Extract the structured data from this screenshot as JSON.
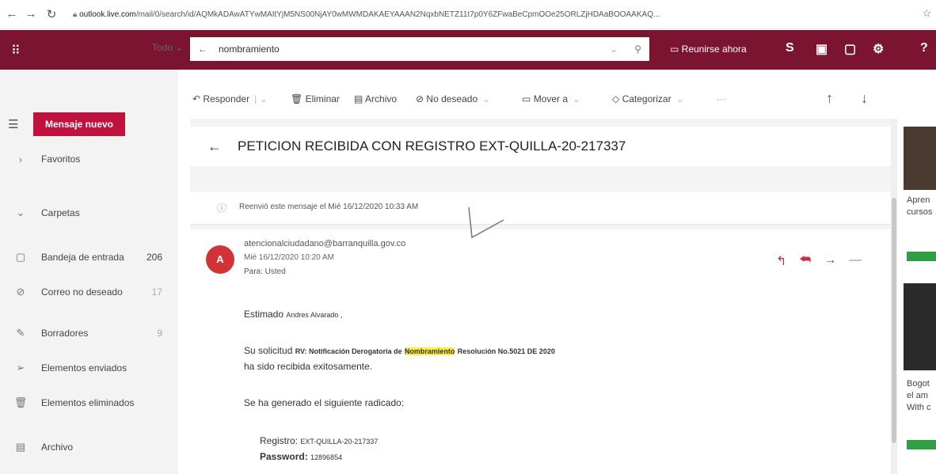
{
  "browser": {
    "url_host": "outlook.live.com",
    "url_path": "/mail/0/search/id/AQMkADAwATYwMAItYjM5NS00NjAY0wMWMDAKAEYAAAN2NqxbNETZ11t7p0Y6ZFwaBeCpmOOe25ORLZjHDAaBOOAAKAQ..."
  },
  "header": {
    "search_scope": "Todo",
    "search_value": "nombramiento",
    "meet_now": "Reunirse ahora"
  },
  "sidebar": {
    "new_message": "Mensaje nuevo",
    "items": [
      {
        "label": "Favoritos",
        "count": ""
      },
      {
        "label": "Carpetas",
        "count": ""
      },
      {
        "label": "Bandeja de entrada",
        "count": "206"
      },
      {
        "label": "Correo no deseado",
        "count": "17"
      },
      {
        "label": "Borradores",
        "count": "9"
      },
      {
        "label": "Elementos enviados",
        "count": ""
      },
      {
        "label": "Elementos eliminados",
        "count": ""
      },
      {
        "label": "Archivo",
        "count": ""
      }
    ]
  },
  "toolbar": {
    "reply": "Responder",
    "delete": "Eliminar",
    "archive": "Archivo",
    "junk": "No deseado",
    "move": "Mover a",
    "categorize": "Categorizar",
    "more": "···"
  },
  "message": {
    "subject": "PETICION RECIBIDA CON REGISTRO EXT-QUILLA-20-217337",
    "forward_info": "Reenvió este mensaje el Mié 16/12/2020 10:33 AM",
    "sender_initial": "A",
    "sender": "atencionalciudadano@barranquilla.gov.co",
    "datetime": "Mié 16/12/2020 10:20 AM",
    "to": "Para: Usted",
    "greeting": "Estimado",
    "greeting_name": "Andres Alvarado ,",
    "line1_prefix": "Su solicitud",
    "line1_bold": "RV: Notificación Derogatoria de",
    "line1_highlight": "Nombramiento",
    "line1_suffix": "Resolución No.5021 DE 2020",
    "line2": "ha sido recibida exitosamente.",
    "line3": "Se ha generado el siguiente radicado:",
    "registro_label": "Registro:",
    "registro_value": "EXT-QUILLA-20-217337",
    "password_label": "Password:",
    "password_value": "12896854"
  },
  "ad": {
    "text1": "Apren cursos",
    "text2": "Bogot el am With c"
  }
}
